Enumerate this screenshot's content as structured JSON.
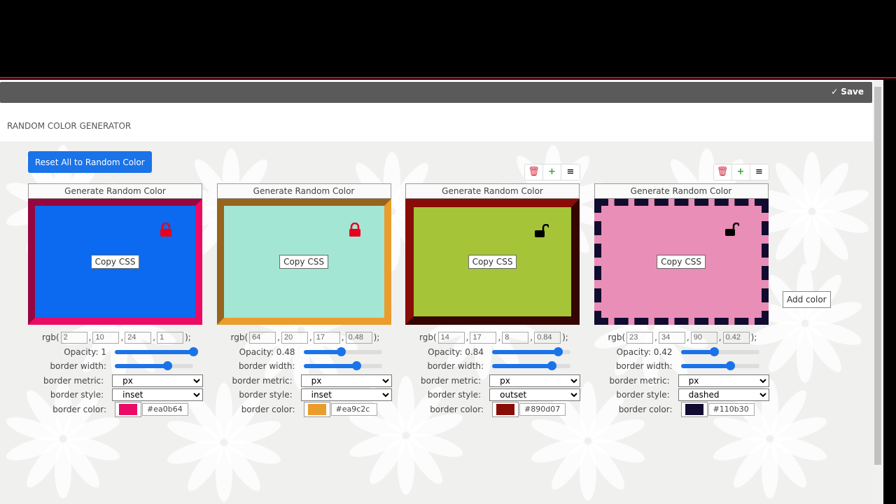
{
  "toolbar": {
    "save_label": "✓ Save"
  },
  "app_title": "RANDOM COLOR GENERATOR",
  "reset_label": "Reset All to Random Color",
  "add_color_label": "Add color",
  "labels": {
    "generate": "Generate Random Color",
    "copy": "Copy CSS",
    "rgb_open": "rgb(",
    "rgb_close": ");",
    "border_width": "border width:",
    "border_metric": "border metric:",
    "border_style": "border style:",
    "border_color": "border color:"
  },
  "cards": [
    {
      "rgb": [
        "2",
        "10",
        "24",
        "1"
      ],
      "opacity_label": "Opacity: 1",
      "opacity": 1,
      "border_width_level": 0.67,
      "metric": "px",
      "style": "inset",
      "border_color": "#ea0b64",
      "fill": "#0b6af0",
      "locked": true,
      "tools": false
    },
    {
      "rgb": [
        "64",
        "20",
        "17",
        "0.48"
      ],
      "opacity_label": "Opacity: 0.48",
      "opacity": 0.48,
      "border_width_level": 0.67,
      "metric": "px",
      "style": "inset",
      "border_color": "#ea9c2c",
      "fill": "#a4e6d4",
      "locked": true,
      "tools": false
    },
    {
      "rgb": [
        "14",
        "17",
        "8",
        "0.84"
      ],
      "opacity_label": "Opacity: 0.84",
      "opacity": 0.84,
      "border_width_level": 0.76,
      "metric": "px",
      "style": "outset",
      "border_color": "#890d07",
      "fill": "#a6c438",
      "locked": false,
      "tools": true
    },
    {
      "rgb": [
        "23",
        "34",
        "90",
        "0.42"
      ],
      "opacity_label": "Opacity: 0.42",
      "opacity": 0.42,
      "border_width_level": 0.63,
      "metric": "px",
      "style": "dashed",
      "border_color": "#110b30",
      "fill": "#e98eb6",
      "locked": false,
      "tools": true
    }
  ]
}
